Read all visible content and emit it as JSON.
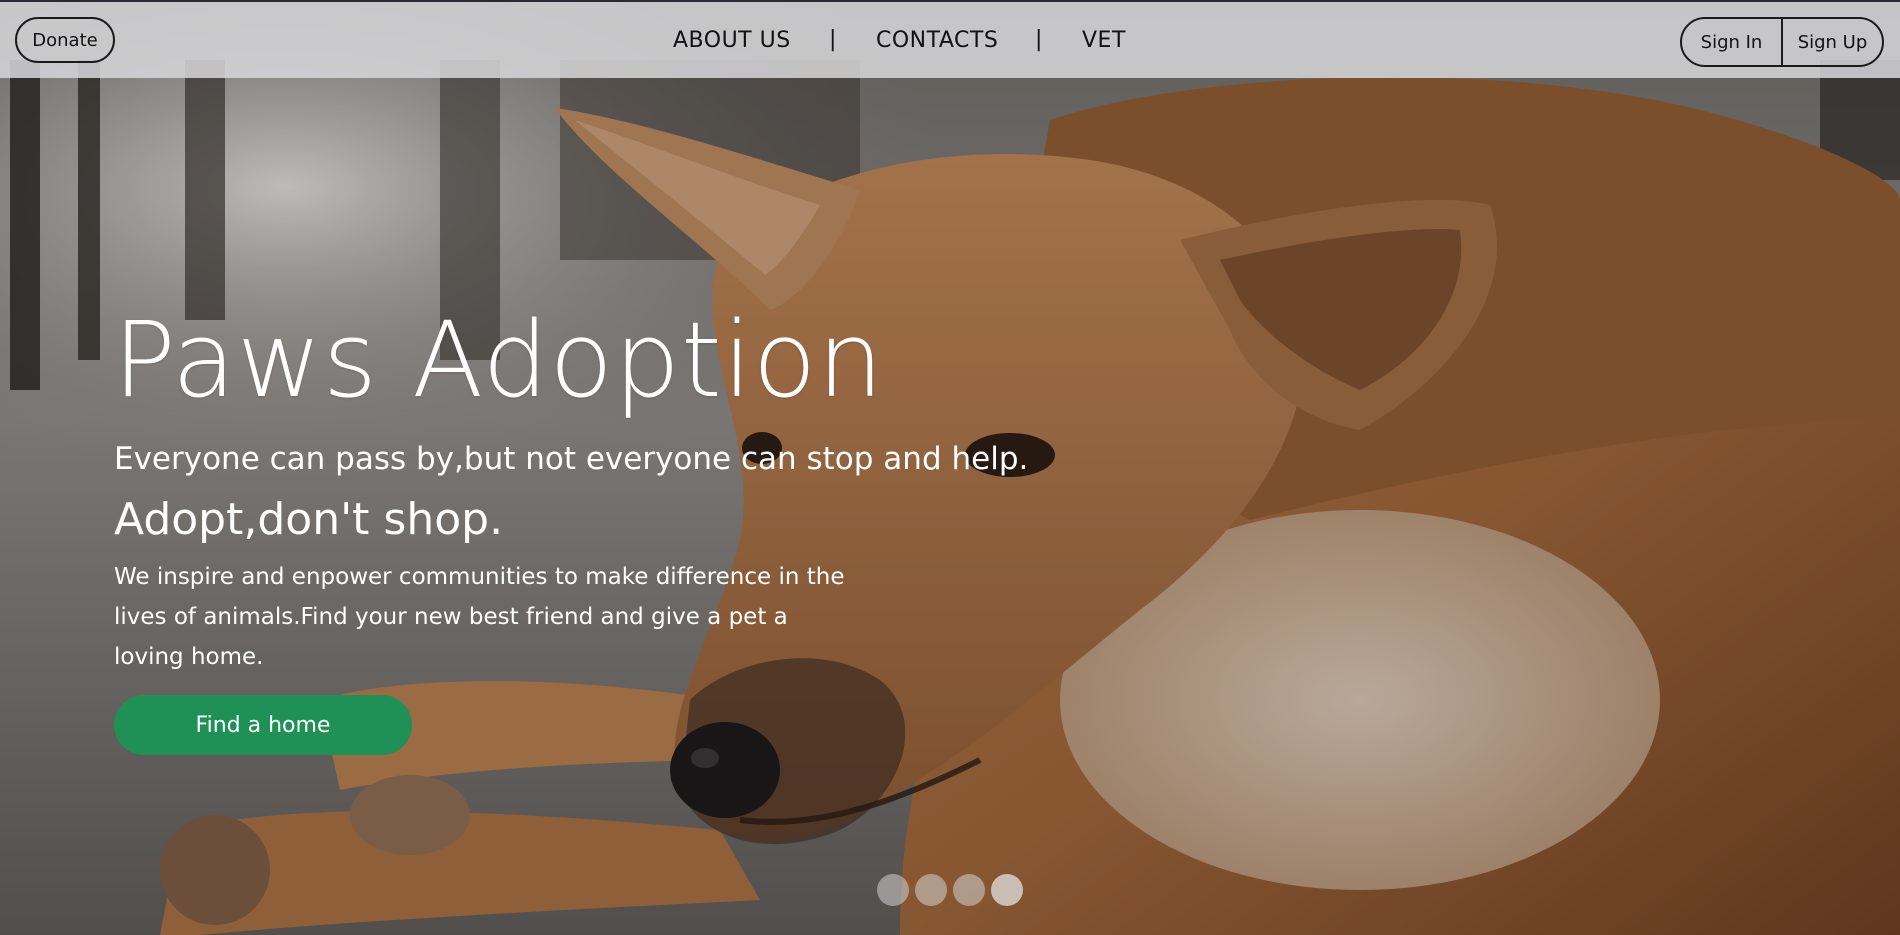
{
  "nav": {
    "donate_label": "Donate",
    "links": [
      {
        "label": "ABOUT US"
      },
      {
        "label": "CONTACTS"
      },
      {
        "label": "VET"
      }
    ],
    "separator": "|",
    "sign_in_label": "Sign In",
    "sign_up_label": "Sign Up"
  },
  "hero": {
    "title": "Paws Adoption",
    "subtitle": "Everyone can pass by,but not everyone can stop and help.",
    "tagline": "Adopt,don't shop.",
    "description": "We inspire and enpower communities to make difference in the lives of animals.Find your new best friend and give a pet a loving home.",
    "cta_label": "Find a home",
    "background_image": "dog-lying-photo"
  },
  "carousel": {
    "slide_count": 4,
    "active_index": 3
  },
  "colors": {
    "cta_green": "#1f9157",
    "navbar_bg": "#d6d6d8",
    "text_light": "#ffffff",
    "text_dark": "#111111"
  }
}
